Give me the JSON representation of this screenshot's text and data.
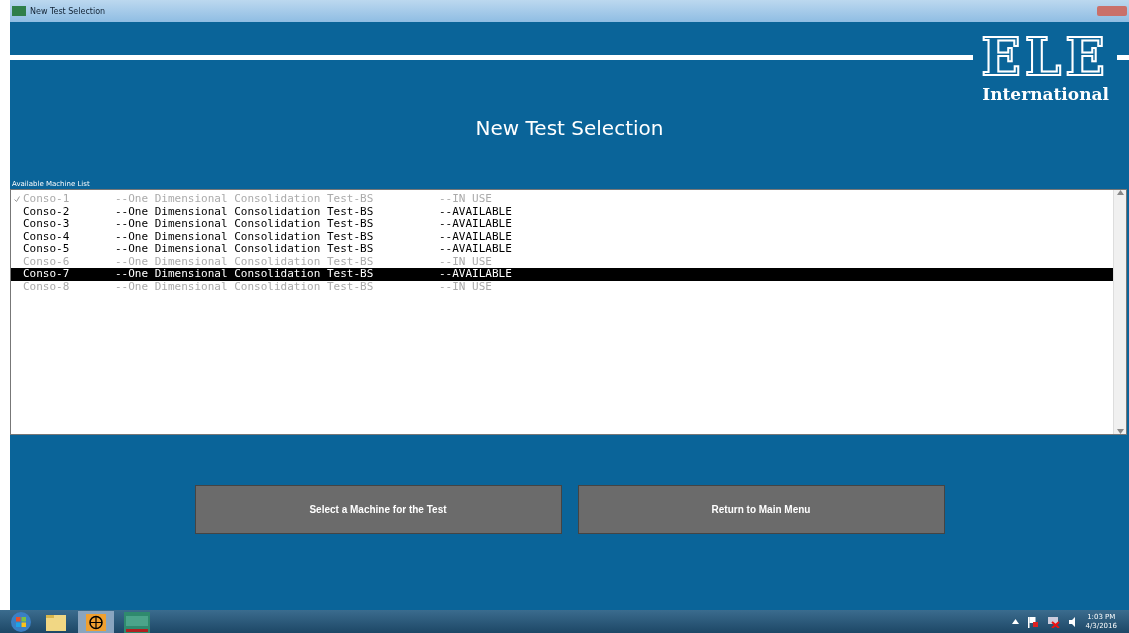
{
  "window": {
    "title": "New Test Selection"
  },
  "logo": {
    "mark": "ELE",
    "subtitle": "International"
  },
  "heading": "New Test Selection",
  "list_label": "Available Machine List",
  "machines": [
    {
      "name": "Conso-1",
      "test": "--One Dimensional Consolidation Test-BS",
      "status": "--IN USE",
      "disabled": true,
      "selected": false,
      "checked": true
    },
    {
      "name": "Conso-2",
      "test": "--One Dimensional Consolidation Test-BS",
      "status": "--AVAILABLE",
      "disabled": false,
      "selected": false,
      "checked": false
    },
    {
      "name": "Conso-3",
      "test": "--One Dimensional Consolidation Test-BS",
      "status": "--AVAILABLE",
      "disabled": false,
      "selected": false,
      "checked": false
    },
    {
      "name": "Conso-4",
      "test": "--One Dimensional Consolidation Test-BS",
      "status": "--AVAILABLE",
      "disabled": false,
      "selected": false,
      "checked": false
    },
    {
      "name": "Conso-5",
      "test": "--One Dimensional Consolidation Test-BS",
      "status": "--AVAILABLE",
      "disabled": false,
      "selected": false,
      "checked": false
    },
    {
      "name": "Conso-6",
      "test": "--One Dimensional Consolidation Test-BS",
      "status": "--IN USE",
      "disabled": true,
      "selected": false,
      "checked": false
    },
    {
      "name": "Conso-7",
      "test": "--One Dimensional Consolidation Test-BS",
      "status": "--AVAILABLE",
      "disabled": false,
      "selected": true,
      "checked": false
    },
    {
      "name": "Conso-8",
      "test": "--One Dimensional Consolidation Test-BS",
      "status": "--IN USE",
      "disabled": true,
      "selected": false,
      "checked": false
    }
  ],
  "buttons": [
    "Select a Machine for the Test",
    "Return to Main Menu"
  ],
  "taskbar": {
    "time": "1:03 PM",
    "date": "4/3/2016"
  }
}
